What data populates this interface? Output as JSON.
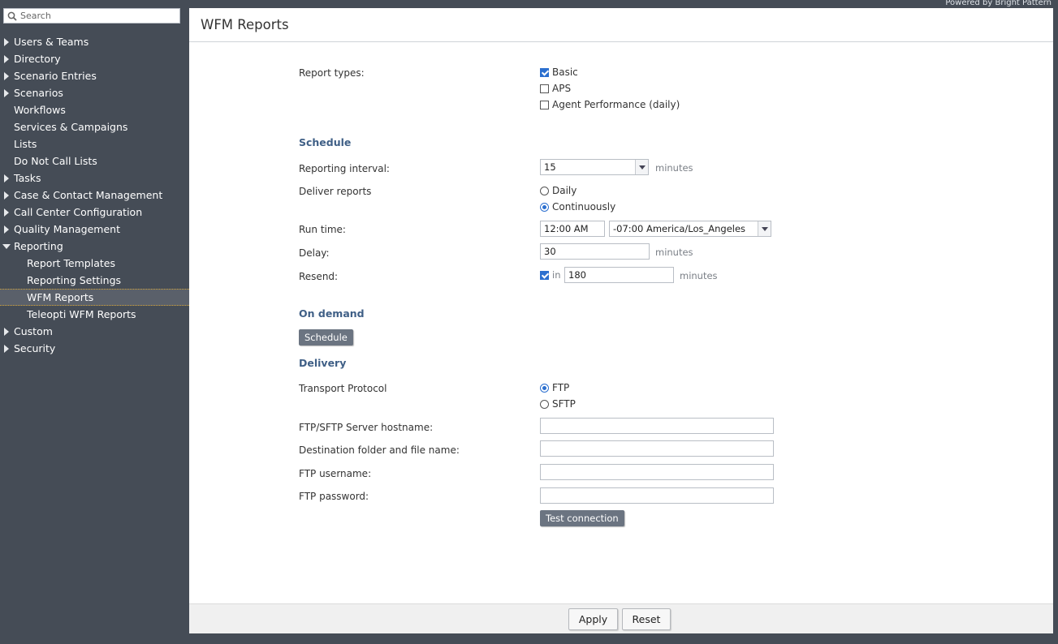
{
  "powered_by": "Powered by Bright Pattern",
  "search": {
    "placeholder": "Search"
  },
  "sidebar": {
    "items": [
      {
        "label": "Users & Teams",
        "arrow": "right",
        "level": 0
      },
      {
        "label": "Directory",
        "arrow": "right",
        "level": 0
      },
      {
        "label": "Scenario Entries",
        "arrow": "right",
        "level": 0
      },
      {
        "label": "Scenarios",
        "arrow": "right",
        "level": 0
      },
      {
        "label": "Workflows",
        "arrow": "none",
        "level": 0
      },
      {
        "label": "Services & Campaigns",
        "arrow": "none",
        "level": 0
      },
      {
        "label": "Lists",
        "arrow": "none",
        "level": 0
      },
      {
        "label": "Do Not Call Lists",
        "arrow": "none",
        "level": 0
      },
      {
        "label": "Tasks",
        "arrow": "right",
        "level": 0
      },
      {
        "label": "Case & Contact Management",
        "arrow": "right",
        "level": 0
      },
      {
        "label": "Call Center Configuration",
        "arrow": "right",
        "level": 0
      },
      {
        "label": "Quality Management",
        "arrow": "right",
        "level": 0
      },
      {
        "label": "Reporting",
        "arrow": "down",
        "level": 0
      },
      {
        "label": "Report Templates",
        "arrow": "none",
        "level": 1
      },
      {
        "label": "Reporting Settings",
        "arrow": "none",
        "level": 1
      },
      {
        "label": "WFM Reports",
        "arrow": "none",
        "level": 1,
        "active": true
      },
      {
        "label": "Teleopti WFM Reports",
        "arrow": "none",
        "level": 1
      },
      {
        "label": "Custom",
        "arrow": "right",
        "level": 0
      },
      {
        "label": "Security",
        "arrow": "right",
        "level": 0
      }
    ]
  },
  "page": {
    "title": "WFM Reports"
  },
  "report_types": {
    "label": "Report types:",
    "options": [
      {
        "label": "Basic",
        "checked": true
      },
      {
        "label": "APS",
        "checked": false
      },
      {
        "label": "Agent Performance (daily)",
        "checked": false
      }
    ]
  },
  "schedule": {
    "heading": "Schedule",
    "interval_label": "Reporting interval:",
    "interval_value": "15",
    "interval_unit": "minutes",
    "deliver_label": "Deliver reports",
    "deliver_options": [
      {
        "label": "Daily",
        "checked": false
      },
      {
        "label": "Continuously",
        "checked": true
      }
    ],
    "run_time_label": "Run time:",
    "run_time_value": "12:00 AM",
    "timezone_value": "-07:00 America/Los_Angeles",
    "delay_label": "Delay:",
    "delay_value": "30",
    "delay_unit": "minutes",
    "resend_label": "Resend:",
    "resend_checked": true,
    "resend_in": "in",
    "resend_value": "180",
    "resend_unit": "minutes"
  },
  "on_demand": {
    "heading": "On demand",
    "schedule_button": "Schedule"
  },
  "delivery": {
    "heading": "Delivery",
    "protocol_label": "Transport Protocol",
    "protocol_options": [
      {
        "label": "FTP",
        "checked": true
      },
      {
        "label": "SFTP",
        "checked": false
      }
    ],
    "hostname_label": "FTP/SFTP Server hostname:",
    "hostname_value": "",
    "folder_label": "Destination folder and file name:",
    "folder_value": "",
    "username_label": "FTP username:",
    "username_value": "",
    "password_label": "FTP password:",
    "password_value": "",
    "test_button": "Test connection"
  },
  "footer": {
    "apply": "Apply",
    "reset": "Reset"
  },
  "colors": {
    "sidebar_bg": "#454c56",
    "section_heading": "#3f5f86",
    "checked_accent": "#2b6fcf",
    "active_border": "#d4a437"
  }
}
